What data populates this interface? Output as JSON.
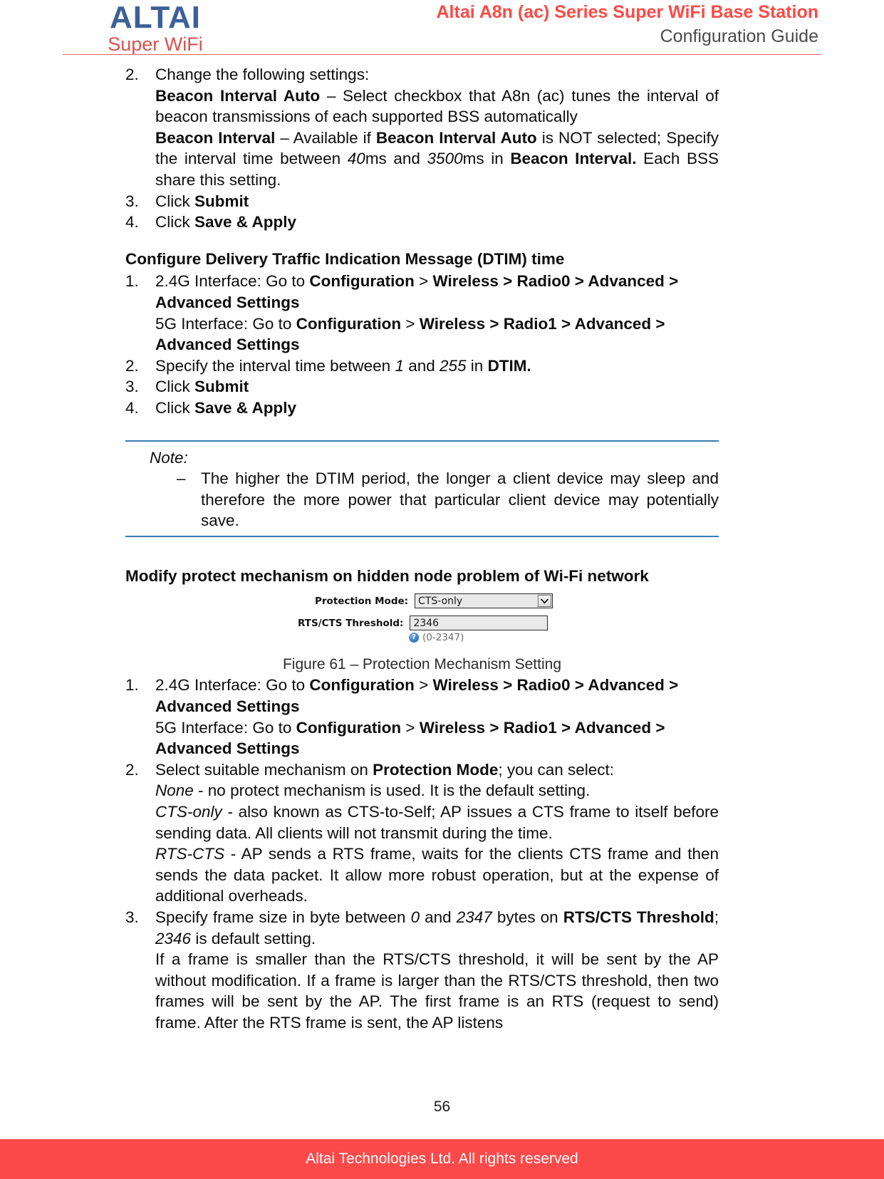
{
  "header": {
    "logo_primary": "ALTAI",
    "logo_secondary": "Super WiFi",
    "title_main": "Altai A8n (ac) Series Super WiFi Base Station",
    "title_sub": "Configuration Guide",
    "brand_blue": "#3c6098",
    "brand_red": "#fa4b46"
  },
  "beacon_section": {
    "step2_num": "2.",
    "step2_text": "Change the following settings:",
    "beacon_auto_label": "Beacon Interval Auto",
    "beacon_auto_desc": " – Select checkbox that A8n (ac) tunes the interval of beacon transmissions of each supported BSS automatically",
    "beacon_label": "Beacon Interval",
    "beacon_desc_1": " – Available if ",
    "beacon_desc_2": "Beacon Interval Auto",
    "beacon_desc_3": " is NOT selected; Specify the interval time between ",
    "beacon_min": "40",
    "beacon_desc_4": "ms and ",
    "beacon_max": "3500",
    "beacon_desc_5": "ms in ",
    "beacon_bold_tail": "Beacon Interval.",
    "beacon_desc_6": " Each BSS share this setting.",
    "step3_num": "3.",
    "step3_click": "Click ",
    "step3_target": "Submit",
    "step4_num": "4.",
    "step4_click": "Click ",
    "step4_target": "Save & Apply"
  },
  "dtim_section": {
    "heading": "Configure Delivery Traffic Indication Message (DTIM) time",
    "step1_num": "1.",
    "step1_prefix_24g": "2.4G Interface: Go to ",
    "step1_path_24g_a": "Configuration",
    "step1_sep": " > ",
    "step1_path_24g_b": "Wireless > Radio0 > Advanced > Advanced Settings",
    "step1_prefix_5g": "5G Interface: Go to ",
    "step1_path_5g_a": "Configuration",
    "step1_path_5g_b": "Wireless > Radio1 > Advanced > Advanced Settings",
    "step2_num": "2.",
    "step2_text_a": "Specify the interval time between ",
    "step2_min": "1",
    "step2_text_b": " and ",
    "step2_max": "255",
    "step2_text_c": " in ",
    "step2_field": "DTIM.",
    "step3_num": "3.",
    "step3_click": "Click ",
    "step3_target": "Submit",
    "step4_num": "4.",
    "step4_click": "Click ",
    "step4_target": "Save & Apply"
  },
  "note": {
    "title": "Note:",
    "dash": "–",
    "text": "The higher the DTIM period, the longer a client device may sleep and therefore the more power that particular client device may potentially save.",
    "border_color": "#3b7ab5"
  },
  "protect_section": {
    "heading": "Modify protect mechanism on hidden node problem of Wi-Fi network",
    "form": {
      "protection_mode_label": "Protection Mode:",
      "protection_mode_value": "CTS-only",
      "protection_mode_options": [
        "None",
        "CTS-only",
        "RTS-CTS"
      ],
      "rts_cts_label": "RTS/CTS Threshold:",
      "rts_cts_value": "2346",
      "range_hint": "(0-2347)",
      "help_glyph": "?"
    },
    "figure_caption": "Figure 61 – Protection Mechanism Setting",
    "step1_num": "1.",
    "step1_prefix_24g": "2.4G Interface: Go to ",
    "step1_path_24g_a": "Configuration",
    "step1_sep": " > ",
    "step1_path_24g_b": "Wireless > Radio0 > Advanced > Advanced Settings",
    "step1_prefix_5g": "5G Interface: Go to ",
    "step1_path_5g_a": "Configuration",
    "step1_path_5g_b": "Wireless > Radio1 > Advanced > Advanced Settings",
    "step2_num": "2.",
    "step2_text_a": "Select suitable mechanism on ",
    "step2_bold": "Protection Mode",
    "step2_text_b": "; you can select:",
    "opt_none_name": "None",
    "opt_none_desc": " - no protect mechanism is used. It is the default setting.",
    "opt_cts_name": "CTS-only",
    "opt_cts_desc": " - also known as CTS-to-Self; AP issues a CTS frame to itself before sending data. All clients will not transmit during the time.",
    "opt_rts_name": "RTS-CTS",
    "opt_rts_desc": " - AP sends a RTS frame, waits for the clients CTS frame and then sends the data packet. It allow more robust operation, but at the expense of additional overheads.",
    "step3_num": "3.",
    "step3_text_a": "Specify frame size in byte between ",
    "step3_min": "0",
    "step3_text_b": " and ",
    "step3_max": "2347",
    "step3_text_c": " bytes on ",
    "step3_bold": "RTS/CTS Threshold",
    "step3_text_d": "; ",
    "step3_default": "2346",
    "step3_text_e": " is default setting.",
    "step3_para": "If a frame is smaller than the RTS/CTS threshold, it will be sent by the AP without modification. If a frame is larger than the RTS/CTS threshold, then two frames will be sent by the AP. The first frame is an RTS (request to send) frame. After the RTS frame is sent, the AP listens"
  },
  "footer": {
    "page_number": "56",
    "copyright": "Altai Technologies Ltd. All rights reserved",
    "bar_color": "#fc4a4a"
  }
}
